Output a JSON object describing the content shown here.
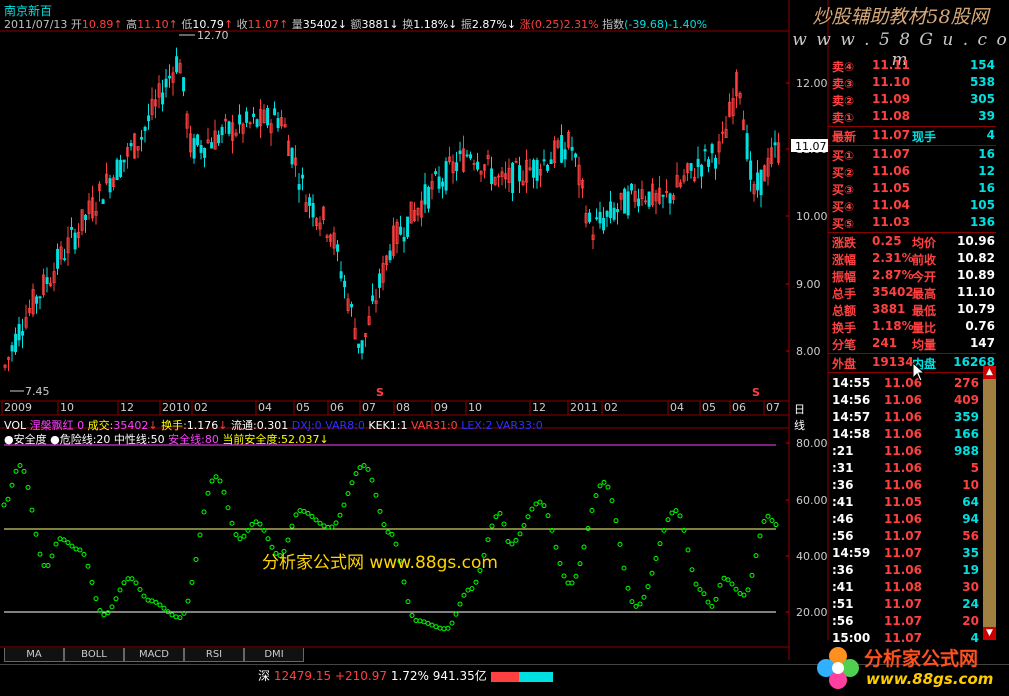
{
  "title": "南京新百",
  "info": {
    "date": "2011/07/13",
    "open_label": "开",
    "open": "10.89",
    "high_label": "高",
    "high": "11.10",
    "low_label": "低",
    "low": "10.79",
    "close_label": "收",
    "close": "11.07",
    "vol_label": "量",
    "vol": "35402",
    "amt_label": "额",
    "amt": "3881",
    "turn_label": "换",
    "turn": "1.18%",
    "amp_label": "振",
    "amp": "2.87%",
    "chg_label": "涨",
    "chg": "(0.25)2.31%",
    "index_label": "指数",
    "index": "(-39.68)-1.40%"
  },
  "price_chart": {
    "max_label": "12.70",
    "min_label": "7.45",
    "current_price_tag": "11.07",
    "y_ticks": [
      "12.00",
      "11.00",
      "10.00",
      "9.00",
      "8.00"
    ],
    "s_markers": [
      "S",
      "S"
    ]
  },
  "time_axis": {
    "labels": [
      "2009",
      "10",
      "12",
      "2010",
      "02",
      "04",
      "05",
      "06",
      "07",
      "08",
      "09",
      "10",
      "12",
      "2011",
      "02",
      "04",
      "05",
      "06",
      "07"
    ],
    "period": "日线"
  },
  "legend1": {
    "vol": "VOL",
    "name": "涅槃飘红",
    "zero": "0",
    "cj_label": "成交",
    "cj": "35402",
    "hs_label": "换手",
    "hs": "1.176",
    "lt_label": "流通",
    "lt": "0.301",
    "v1": "DXJ:0",
    "v2": "VAR8:0",
    "v3": "KEK1:1",
    "v4": "VAR31:0",
    "v5": "LEX:2",
    "v6": "VAR33:0"
  },
  "legend2": {
    "safe": "安全度",
    "danger": "危险线:20",
    "middle": "中性线:50",
    "safeline": "安全线:80",
    "current": "当前安全度:52.037"
  },
  "indicator": {
    "y_ticks": [
      "80.00",
      "60.00",
      "40.00",
      "20.00"
    ]
  },
  "watermark": "分析家公式网  www.88gs.com",
  "ad": {
    "title": "炒股辅助教材58股网",
    "url": "w w w . 5 8 G u . c o m"
  },
  "quote": {
    "asks": [
      {
        "label": "卖④",
        "price": "11.11",
        "vol": "154"
      },
      {
        "label": "卖③",
        "price": "11.10",
        "vol": "538"
      },
      {
        "label": "卖②",
        "price": "11.09",
        "vol": "305"
      },
      {
        "label": "卖①",
        "price": "11.08",
        "vol": "39"
      }
    ],
    "latest": {
      "label": "最新",
      "price": "11.07",
      "hand_label": "现手",
      "hand": "4"
    },
    "bids": [
      {
        "label": "买①",
        "price": "11.07",
        "vol": "16"
      },
      {
        "label": "买②",
        "price": "11.06",
        "vol": "12"
      },
      {
        "label": "买③",
        "price": "11.05",
        "vol": "16"
      },
      {
        "label": "买④",
        "price": "11.04",
        "vol": "105"
      },
      {
        "label": "买⑤",
        "price": "11.03",
        "vol": "136"
      }
    ],
    "stats": [
      {
        "l1": "涨跌",
        "v1": "0.25",
        "l2": "均价",
        "v2": "10.96"
      },
      {
        "l1": "涨幅",
        "v1": "2.31%",
        "l2": "前收",
        "v2": "10.82"
      },
      {
        "l1": "振幅",
        "v1": "2.87%",
        "l2": "今开",
        "v2": "10.89"
      },
      {
        "l1": "总手",
        "v1": "35402",
        "l2": "最高",
        "v2": "11.10"
      },
      {
        "l1": "总额",
        "v1": "3881",
        "l2": "最低",
        "v2": "10.79"
      },
      {
        "l1": "换手",
        "v1": "1.18%",
        "l2": "量比",
        "v2": "0.76"
      },
      {
        "l1": "分笔",
        "v1": "241",
        "l2": "均量",
        "v2": "147"
      }
    ],
    "outer_label": "外盘",
    "outer": "19134",
    "inner_label": "内盘",
    "inner": "16268"
  },
  "ticks": [
    {
      "time": "14:55",
      "price": "11.06",
      "vol": "276"
    },
    {
      "time": "14:56",
      "price": "11.06",
      "vol": "409"
    },
    {
      "time": "14:57",
      "price": "11.06",
      "vol": "359"
    },
    {
      "time": "14:58",
      "price": "11.06",
      "vol": "166"
    },
    {
      "time": ":21",
      "price": "11.06",
      "vol": "988"
    },
    {
      "time": ":31",
      "price": "11.06",
      "vol": "5"
    },
    {
      "time": ":36",
      "price": "11.06",
      "vol": "10"
    },
    {
      "time": ":41",
      "price": "11.05",
      "vol": "64"
    },
    {
      "time": ":46",
      "price": "11.06",
      "vol": "94"
    },
    {
      "time": ":56",
      "price": "11.07",
      "vol": "56"
    },
    {
      "time": "14:59",
      "price": "11.07",
      "vol": "35"
    },
    {
      "time": ":36",
      "price": "11.06",
      "vol": "19"
    },
    {
      "time": ":41",
      "price": "11.08",
      "vol": "30"
    },
    {
      "time": ":51",
      "price": "11.07",
      "vol": "24"
    },
    {
      "time": ":56",
      "price": "11.07",
      "vol": "20"
    },
    {
      "time": "15:00",
      "price": "11.07",
      "vol": "4"
    }
  ],
  "tabs": [
    "MA",
    "BOLL",
    "MACD",
    "RSI",
    "DMI"
  ],
  "status": {
    "market": "深",
    "index": "12479.15",
    "change": "+210.97",
    "pct": "1.72%",
    "amount": "941.35亿"
  },
  "logo": {
    "title": "分析家公式网",
    "url": "www.88gs.com"
  },
  "colors": {
    "up": "#ff4040",
    "down": "#00e0e0",
    "indicator": "#00ff00",
    "grid": "#8b0000"
  }
}
